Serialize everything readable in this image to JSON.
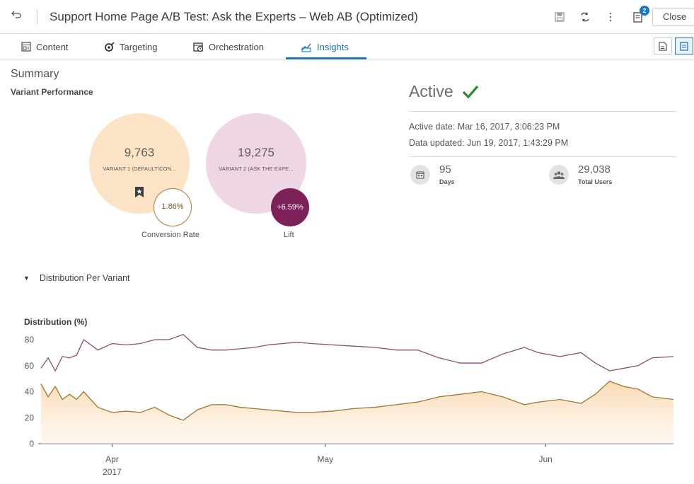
{
  "titlebar": {
    "title": "Support Home Page A/B Test: Ask the Experts – Web AB (Optimized)",
    "notification_count": "2",
    "close_label": "Close"
  },
  "tabs": [
    {
      "label": "Content",
      "icon": "content-icon",
      "active": false
    },
    {
      "label": "Targeting",
      "icon": "targeting-icon",
      "active": false
    },
    {
      "label": "Orchestration",
      "icon": "orchestration-icon",
      "active": false
    },
    {
      "label": "Insights",
      "icon": "insights-icon",
      "active": true
    }
  ],
  "summary": {
    "title": "Summary",
    "variant_performance_title": "Variant Performance",
    "variant1": {
      "count": "9,763",
      "label": "VARIANT 1 (DEFAULT/CON..."
    },
    "variant2": {
      "count": "19,275",
      "label": "VARIANT 2 (ASK THE EXPE..."
    },
    "conversion_rate": "1.86%",
    "conversion_caption": "Conversion Rate",
    "lift": "+6.59%",
    "lift_caption": "Lift"
  },
  "status": {
    "label": "Active",
    "active_date": "Active date:  Mar 16, 2017, 3:06:23 PM",
    "data_updated": "Data updated:  Jun 19, 2017, 1:43:29 PM",
    "days_value": "95",
    "days_label": "Days",
    "users_value": "29,038",
    "users_label": "Total Users"
  },
  "distribution": {
    "section_label": "Distribution Per Variant"
  },
  "colors": {
    "accent": "#1a73c6",
    "variant1": "#fde3c6",
    "variant1_line": "#9b7634",
    "variant2": "#eed6e4",
    "variant2_line": "#8c4c78",
    "lift": "#7d2258",
    "check": "#2a8a2a"
  },
  "chart_data": {
    "type": "line",
    "ylabel": "Distribution (%)",
    "ylim": [
      0,
      80
    ],
    "y_ticks": [
      "0",
      "20",
      "40",
      "60",
      "80"
    ],
    "x_ticks": [
      {
        "date": "2017-04-01",
        "label": "Apr",
        "sublabel": "2017"
      },
      {
        "date": "2017-05-01",
        "label": "May",
        "sublabel": ""
      },
      {
        "date": "2017-06-01",
        "label": "Jun",
        "sublabel": ""
      }
    ],
    "x_range": [
      "2017-03-22",
      "2017-06-19"
    ],
    "series": [
      {
        "key": "variant2",
        "x": [
          "2017-03-22",
          "2017-03-23",
          "2017-03-24",
          "2017-03-25",
          "2017-03-26",
          "2017-03-27",
          "2017-03-28",
          "2017-03-30",
          "2017-04-01",
          "2017-04-03",
          "2017-04-05",
          "2017-04-07",
          "2017-04-09",
          "2017-04-11",
          "2017-04-13",
          "2017-04-15",
          "2017-04-17",
          "2017-04-19",
          "2017-04-21",
          "2017-04-23",
          "2017-04-25",
          "2017-04-27",
          "2017-04-29",
          "2017-05-02",
          "2017-05-05",
          "2017-05-08",
          "2017-05-11",
          "2017-05-14",
          "2017-05-17",
          "2017-05-20",
          "2017-05-23",
          "2017-05-26",
          "2017-05-29",
          "2017-05-31",
          "2017-06-03",
          "2017-06-06",
          "2017-06-08",
          "2017-06-10",
          "2017-06-12",
          "2017-06-14",
          "2017-06-16",
          "2017-06-19"
        ],
        "y": [
          58,
          66,
          56,
          67,
          66,
          68,
          80,
          72,
          77,
          76,
          77,
          80,
          80,
          84,
          74,
          72,
          72,
          73,
          74,
          76,
          77,
          78,
          77,
          76,
          75,
          74,
          72,
          72,
          66,
          62,
          62,
          69,
          74,
          70,
          67,
          70,
          62,
          56,
          58,
          60,
          66,
          67
        ]
      },
      {
        "key": "variant1",
        "x": [
          "2017-03-22",
          "2017-03-23",
          "2017-03-24",
          "2017-03-25",
          "2017-03-26",
          "2017-03-27",
          "2017-03-28",
          "2017-03-30",
          "2017-04-01",
          "2017-04-03",
          "2017-04-05",
          "2017-04-07",
          "2017-04-09",
          "2017-04-11",
          "2017-04-13",
          "2017-04-15",
          "2017-04-17",
          "2017-04-19",
          "2017-04-21",
          "2017-04-23",
          "2017-04-25",
          "2017-04-27",
          "2017-04-29",
          "2017-05-02",
          "2017-05-05",
          "2017-05-08",
          "2017-05-11",
          "2017-05-14",
          "2017-05-17",
          "2017-05-20",
          "2017-05-23",
          "2017-05-26",
          "2017-05-29",
          "2017-05-31",
          "2017-06-03",
          "2017-06-06",
          "2017-06-08",
          "2017-06-10",
          "2017-06-12",
          "2017-06-14",
          "2017-06-16",
          "2017-06-19"
        ],
        "y": [
          46,
          36,
          44,
          34,
          38,
          34,
          40,
          28,
          24,
          25,
          24,
          28,
          22,
          18,
          26,
          30,
          30,
          28,
          27,
          26,
          25,
          24,
          24,
          25,
          27,
          28,
          30,
          32,
          36,
          38,
          40,
          36,
          30,
          32,
          34,
          31,
          38,
          48,
          44,
          42,
          36,
          34
        ]
      }
    ]
  }
}
